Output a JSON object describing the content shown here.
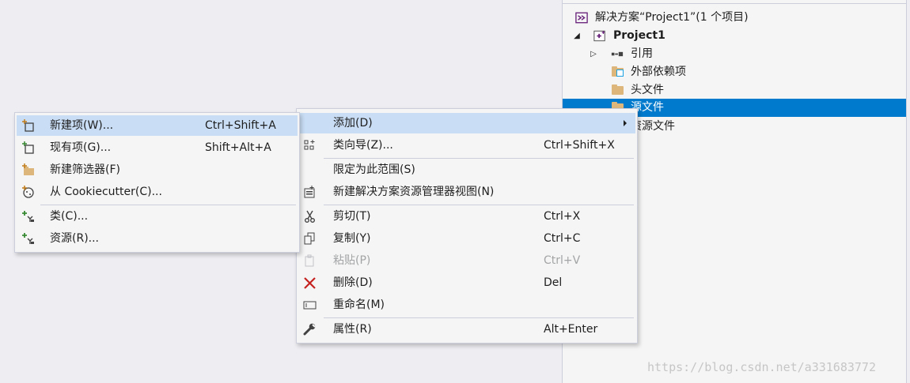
{
  "solution_explorer": {
    "solution_label": "解决方案“Project1”(1 个项目)",
    "project_label": "Project1",
    "items": [
      {
        "label": "引用"
      },
      {
        "label": "外部依赖项"
      },
      {
        "label": "头文件"
      },
      {
        "label": "源文件",
        "selected": true
      },
      {
        "label": "资源文件"
      }
    ]
  },
  "context_menu": {
    "items": [
      {
        "label": "添加(D)",
        "shortcut": "",
        "icon": "none",
        "has_submenu": true,
        "highlighted": true
      },
      {
        "label": "类向导(Z)...",
        "shortcut": "Ctrl+Shift+X",
        "icon": "class-wizard-icon"
      },
      {
        "label": "限定为此范围(S)",
        "shortcut": "",
        "icon": "none"
      },
      {
        "label": "新建解决方案资源管理器视图(N)",
        "shortcut": "",
        "icon": "new-explorer-view-icon"
      },
      {
        "label": "剪切(T)",
        "shortcut": "Ctrl+X",
        "icon": "cut-icon"
      },
      {
        "label": "复制(Y)",
        "shortcut": "Ctrl+C",
        "icon": "copy-icon"
      },
      {
        "label": "粘贴(P)",
        "shortcut": "Ctrl+V",
        "icon": "paste-icon",
        "disabled": true
      },
      {
        "label": "删除(D)",
        "shortcut": "Del",
        "icon": "delete-icon"
      },
      {
        "label": "重命名(M)",
        "shortcut": "",
        "icon": "rename-icon"
      },
      {
        "label": "属性(R)",
        "shortcut": "Alt+Enter",
        "icon": "properties-wrench-icon"
      }
    ]
  },
  "add_submenu": {
    "items": [
      {
        "label": "新建项(W)...",
        "shortcut": "Ctrl+Shift+A",
        "icon": "new-item-icon",
        "highlighted": true
      },
      {
        "label": "现有项(G)...",
        "shortcut": "Shift+Alt+A",
        "icon": "existing-item-icon"
      },
      {
        "label": "新建筛选器(F)",
        "shortcut": "",
        "icon": "new-filter-icon"
      },
      {
        "label": "从 Cookiecutter(C)...",
        "shortcut": "",
        "icon": "cookiecutter-icon"
      },
      {
        "label": "类(C)...",
        "shortcut": "",
        "icon": "add-class-icon"
      },
      {
        "label": "资源(R)...",
        "shortcut": "",
        "icon": "add-resource-icon"
      }
    ]
  },
  "watermark": "https://blog.csdn.net/a331683772",
  "colors": {
    "selection": "#007acc",
    "menu_highlight": "#c9def5",
    "menu_bg": "#f5f5f5"
  }
}
